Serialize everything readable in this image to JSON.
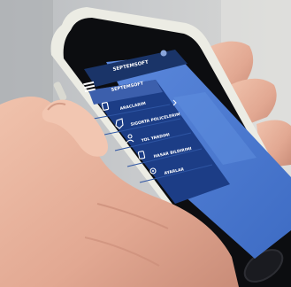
{
  "app": {
    "title": "SEPTEMSOFT",
    "active_item": "SEPTEMSOFT"
  },
  "menu": {
    "items": [
      {
        "label": "ARACLARIM",
        "icon": "document-icon"
      },
      {
        "label": "SIGORTA POLICELERIM",
        "icon": "shield-icon"
      },
      {
        "label": "YOL YARDIMI",
        "icon": "user-icon"
      },
      {
        "label": "HASAR BILDIRIMI",
        "icon": "clipboard-icon"
      },
      {
        "label": "AYARLAR",
        "icon": "gear-icon"
      }
    ]
  },
  "colors": {
    "menu_bg": "#1c3d86",
    "menu_active_bg": "#3c5fac",
    "content_bg": "#4a7ad2",
    "header_bg": "#1a3468",
    "phone_case": "#ecece4",
    "phone_bezel": "#0c0d10",
    "skin": "#e8b29c",
    "background": "#bfc2c5"
  }
}
